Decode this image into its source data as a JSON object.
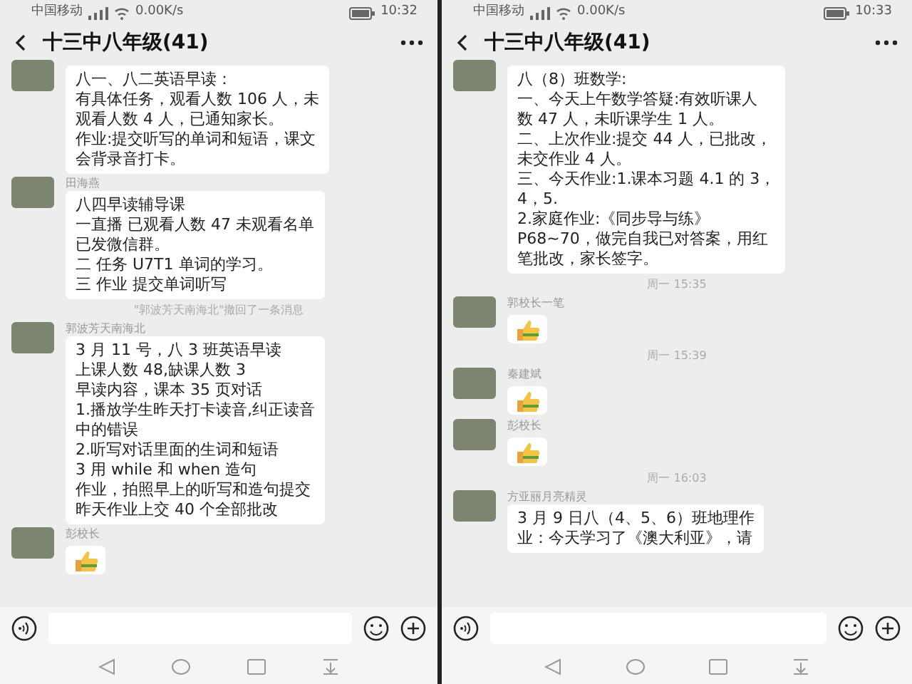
{
  "phones": [
    {
      "status": {
        "carrier": "中国移动",
        "speed": "0.00K/s",
        "time": "10:32"
      },
      "title": "十三中八年级(41)",
      "items": [
        {
          "kind": "message",
          "lines": [
            "八一、八二英语早读：",
            "有具体任务，观看人数 106 人，未",
            "观看人数 4 人，已通知家长。",
            "作业:提交听写的单词和短语，课文",
            "会背录音打卡。"
          ]
        },
        {
          "kind": "message",
          "sender": "田海燕",
          "lines": [
            "八四早读辅导课",
            "一直播 已观看人数  47  未观看名单",
            "已发微信群。",
            "二 任务 U7T1 单词的学习。",
            "三  作业 提交单词听写"
          ]
        },
        {
          "kind": "notice",
          "text": "\"郭波芳天南海北\"撤回了一条消息"
        },
        {
          "kind": "message",
          "sender": "郭波芳天南海北",
          "lines": [
            "3 月 11 号，八 3 班英语早读",
            "上课人数 48,缺课人数 3",
            "早读内容，课本 35 页对话",
            "1.播放学生昨天打卡读音,纠正读音",
            "中的错误",
            "2.听写对话里面的生词和短语",
            "3 用 while 和 when 造句",
            "作业，拍照早上的听写和造句提交",
            "昨天作业上交 40 个全部批改"
          ]
        },
        {
          "kind": "like",
          "sender": "彭校长"
        }
      ]
    },
    {
      "status": {
        "carrier": "中国移动",
        "speed": "0.00K/s",
        "time": "10:33"
      },
      "title": "十三中八年级(41)",
      "items": [
        {
          "kind": "message",
          "lines": [
            "八（8）班数学:",
            "一、今天上午数学答疑:有效听课人",
            "数 47 人，未听课学生 1 人。",
            "二、上次作业:提交 44 人，已批改，",
            "未交作业 4 人。",
            "三、今天作业:1.课本习题 4.1 的 3，",
            "4，5.",
            "2.家庭作业:《同步导与练》",
            "P68~70，做完自我已对答案，用红",
            "笔批改，家长签字。"
          ]
        },
        {
          "kind": "time",
          "text": "周一 15:35"
        },
        {
          "kind": "like",
          "sender": "郭校长一笔"
        },
        {
          "kind": "time",
          "text": "周一 15:39"
        },
        {
          "kind": "like",
          "sender": "秦建斌"
        },
        {
          "kind": "like",
          "sender": "彭校长"
        },
        {
          "kind": "time",
          "text": "周一 16:03"
        },
        {
          "kind": "message",
          "sender": "方亚丽月亮精灵",
          "lines": [
            "3 月 9 日八（4、5、6）班地理作",
            "业：今天学习了《澳大利亚》，请"
          ]
        }
      ]
    }
  ]
}
